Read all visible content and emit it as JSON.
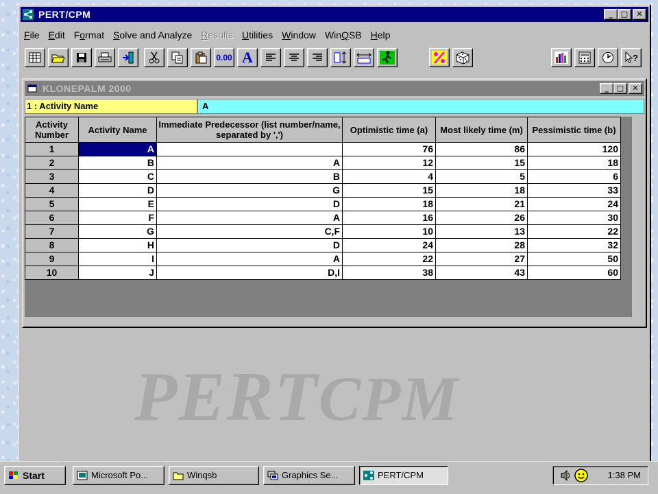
{
  "app": {
    "title": "PERT/CPM",
    "window_buttons": {
      "minimize": "_",
      "maximize": "□",
      "close": "✕"
    }
  },
  "menu": [
    {
      "pre": "",
      "u": "F",
      "post": "ile",
      "disabled": false
    },
    {
      "pre": "",
      "u": "E",
      "post": "dit",
      "disabled": false
    },
    {
      "pre": "F",
      "u": "o",
      "post": "rmat",
      "disabled": false
    },
    {
      "pre": "",
      "u": "S",
      "post": "olve and Analyze",
      "disabled": false
    },
    {
      "pre": "",
      "u": "R",
      "post": "esults",
      "disabled": true
    },
    {
      "pre": "",
      "u": "U",
      "post": "tilities",
      "disabled": false
    },
    {
      "pre": "",
      "u": "W",
      "post": "indow",
      "disabled": false
    },
    {
      "pre": "Win",
      "u": "Q",
      "post": "SB",
      "disabled": false
    },
    {
      "pre": "",
      "u": "H",
      "post": "elp",
      "disabled": false
    }
  ],
  "toolbar": {
    "number_format_label": "0.00",
    "font_label": "A"
  },
  "child_window": {
    "title": "KLONEPALM 2000",
    "cell_reference": "1 : Activity Name",
    "cell_value": "A"
  },
  "table": {
    "headers": [
      "Activity Number",
      "Activity Name",
      "Immediate Predecessor (list number/name, separated by ',')",
      "Optimistic time (a)",
      "Most likely time (m)",
      "Pessimistic time (b)"
    ],
    "rows": [
      {
        "num": "1",
        "name": "A",
        "pred": "",
        "a": "76",
        "m": "86",
        "b": "120"
      },
      {
        "num": "2",
        "name": "B",
        "pred": "A",
        "a": "12",
        "m": "15",
        "b": "18"
      },
      {
        "num": "3",
        "name": "C",
        "pred": "B",
        "a": "4",
        "m": "5",
        "b": "6"
      },
      {
        "num": "4",
        "name": "D",
        "pred": "G",
        "a": "15",
        "m": "18",
        "b": "33"
      },
      {
        "num": "5",
        "name": "E",
        "pred": "D",
        "a": "18",
        "m": "21",
        "b": "24"
      },
      {
        "num": "6",
        "name": "F",
        "pred": "A",
        "a": "16",
        "m": "26",
        "b": "30"
      },
      {
        "num": "7",
        "name": "G",
        "pred": "C,F",
        "a": "10",
        "m": "13",
        "b": "22"
      },
      {
        "num": "8",
        "name": "H",
        "pred": "D",
        "a": "24",
        "m": "28",
        "b": "32"
      },
      {
        "num": "9",
        "name": "I",
        "pred": "A",
        "a": "22",
        "m": "27",
        "b": "50"
      },
      {
        "num": "10",
        "name": "J",
        "pred": "D,I",
        "a": "38",
        "m": "43",
        "b": "60"
      }
    ]
  },
  "watermark": {
    "main": "PERT",
    "sub": "CPM"
  },
  "taskbar": {
    "start": "Start",
    "tasks": [
      "Microsoft Po...",
      "Winqsb",
      "Graphics Se...",
      "PERT/CPM"
    ],
    "clock": "1:38 PM"
  },
  "colors": {
    "title_active": "#000080",
    "title_inactive": "#808080",
    "cell_reference_bg": "#ffff80",
    "cell_value_bg": "#80ffff",
    "selection": "#000080",
    "face": "#c0c0c0"
  }
}
